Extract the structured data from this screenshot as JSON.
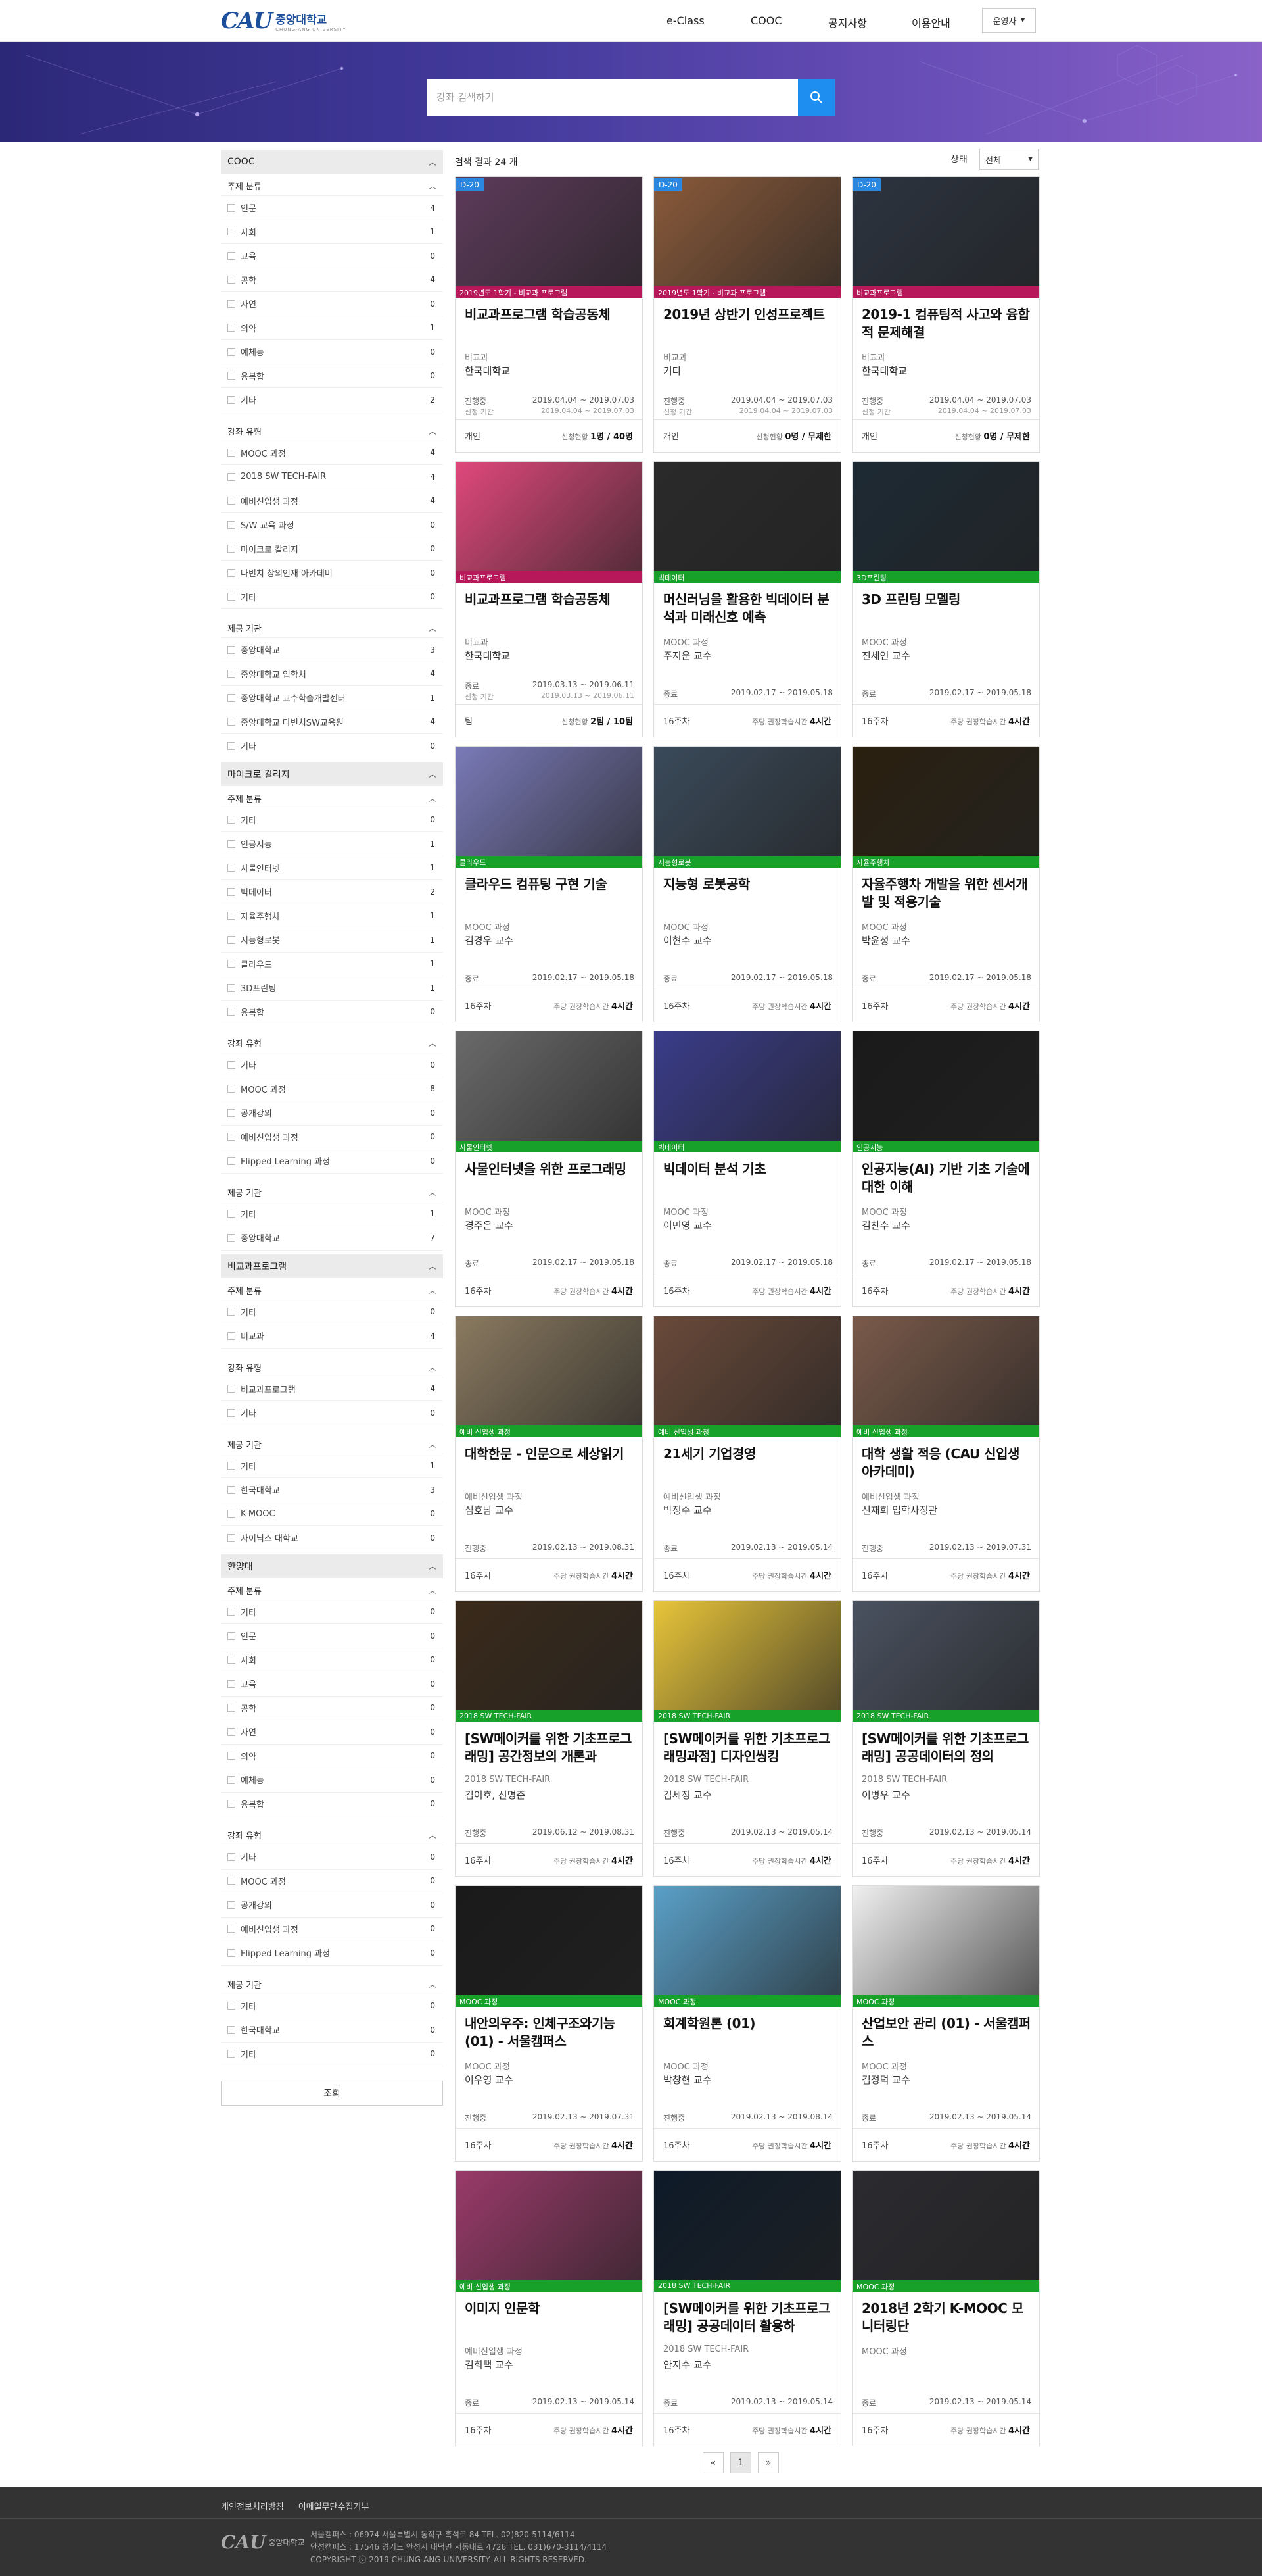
{
  "header": {
    "logo_mark": "CAU",
    "logo_kor": "중앙대학교",
    "logo_eng": "CHUNG-ANG UNIVERSITY",
    "nav": [
      "e-Class",
      "COOC",
      "공지사항",
      "이용안내"
    ],
    "operator_select": "운영자"
  },
  "search": {
    "placeholder": "강좌 검색하기"
  },
  "sidebar": {
    "groups": [
      {
        "title": "COOC",
        "subsections": [
          {
            "title": "주제 분류",
            "items": [
              [
                "인문",
                "4"
              ],
              [
                "사회",
                "1"
              ],
              [
                "교육",
                "0"
              ],
              [
                "공학",
                "4"
              ],
              [
                "자연",
                "0"
              ],
              [
                "의약",
                "1"
              ],
              [
                "예체능",
                "0"
              ],
              [
                "융복합",
                "0"
              ],
              [
                "기타",
                "2"
              ]
            ]
          },
          {
            "title": "강좌 유형",
            "items": [
              [
                "MOOC 과정",
                "4"
              ],
              [
                "2018 SW TECH-FAIR",
                "4"
              ],
              [
                "예비신입생 과정",
                "4"
              ],
              [
                "S/W 교육 과정",
                "0"
              ],
              [
                "마이크로 칼리지",
                "0"
              ],
              [
                "다빈치 창의인재 아카데미",
                "0"
              ],
              [
                "기타",
                "0"
              ]
            ]
          },
          {
            "title": "제공 기관",
            "items": [
              [
                "중앙대학교",
                "3"
              ],
              [
                "중앙대학교 입학처",
                "4"
              ],
              [
                "중앙대학교 교수학습개발센터",
                "1"
              ],
              [
                "중앙대학교 다빈치SW교육원",
                "4"
              ],
              [
                "기타",
                "0"
              ]
            ]
          }
        ]
      },
      {
        "title": "마이크로 칼리지",
        "subsections": [
          {
            "title": "주제 분류",
            "items": [
              [
                "기타",
                "0"
              ],
              [
                "인공지능",
                "1"
              ],
              [
                "사물인터넷",
                "1"
              ],
              [
                "빅데이터",
                "2"
              ],
              [
                "자율주행차",
                "1"
              ],
              [
                "지능형로봇",
                "1"
              ],
              [
                "클라우드",
                "1"
              ],
              [
                "3D프린팅",
                "1"
              ],
              [
                "융복합",
                "0"
              ]
            ]
          },
          {
            "title": "강좌 유형",
            "items": [
              [
                "기타",
                "0"
              ],
              [
                "MOOC 과정",
                "8"
              ],
              [
                "공개강의",
                "0"
              ],
              [
                "예비신입생 과정",
                "0"
              ],
              [
                "Flipped Learning 과정",
                "0"
              ]
            ]
          },
          {
            "title": "제공 기관",
            "items": [
              [
                "기타",
                "1"
              ],
              [
                "중앙대학교",
                "7"
              ]
            ]
          }
        ]
      },
      {
        "title": "비교과프로그램",
        "subsections": [
          {
            "title": "주제 분류",
            "items": [
              [
                "기타",
                "0"
              ],
              [
                "비교과",
                "4"
              ]
            ]
          },
          {
            "title": "강좌 유형",
            "items": [
              [
                "비교과프로그램",
                "4"
              ],
              [
                "기타",
                "0"
              ]
            ]
          },
          {
            "title": "제공 기관",
            "items": [
              [
                "기타",
                "1"
              ],
              [
                "한국대학교",
                "3"
              ],
              [
                "K-MOOC",
                "0"
              ],
              [
                "자이닉스 대학교",
                "0"
              ]
            ]
          }
        ]
      },
      {
        "title": "한양대",
        "subsections": [
          {
            "title": "주제 분류",
            "items": [
              [
                "기타",
                "0"
              ],
              [
                "인문",
                "0"
              ],
              [
                "사회",
                "0"
              ],
              [
                "교육",
                "0"
              ],
              [
                "공학",
                "0"
              ],
              [
                "자연",
                "0"
              ],
              [
                "의약",
                "0"
              ],
              [
                "예체능",
                "0"
              ],
              [
                "융복합",
                "0"
              ]
            ]
          },
          {
            "title": "강좌 유형",
            "items": [
              [
                "기타",
                "0"
              ],
              [
                "MOOC 과정",
                "0"
              ],
              [
                "공개강의",
                "0"
              ],
              [
                "예비신입생 과정",
                "0"
              ],
              [
                "Flipped Learning 과정",
                "0"
              ]
            ]
          },
          {
            "title": "제공 기관",
            "items": [
              [
                "기타",
                "0"
              ],
              [
                "한국대학교",
                "0"
              ],
              [
                "기타",
                "0"
              ]
            ]
          }
        ]
      }
    ],
    "query_button": "조회"
  },
  "main": {
    "result_count": "검색 결과 24 개",
    "status_label": "상태",
    "status_value": "전체"
  },
  "courses": [
    {
      "dday": "D-20",
      "cat": "2019년도 1학기 - 비교과 프로그램",
      "cat_color": "pink",
      "title": "비교과프로그램 학습공동체",
      "type": "비교과",
      "prof": "한국대학교",
      "state": "진행중",
      "period": "2019.04.04  ~  2019.07.03",
      "apply_label": "신청 기간",
      "apply": "2019.04.04  ~  2019.07.03",
      "foot_left": "개인",
      "foot_right_label": "신청현황",
      "foot_right": "1명 / 40명",
      "img": "#5d3a5a"
    },
    {
      "dday": "D-20",
      "cat": "2019년도 1학기 - 비교과 프로그램",
      "cat_color": "pink",
      "title": "2019년 상반기 인성프로젝트",
      "type": "비교과",
      "prof": "기타",
      "state": "진행중",
      "period": "2019.04.04  ~  2019.07.03",
      "apply_label": "신청 기간",
      "apply": "2019.04.04  ~  2019.07.03",
      "foot_left": "개인",
      "foot_right_label": "신청현황",
      "foot_right": "0명 / 무제한",
      "img": "#8a5a3a"
    },
    {
      "dday": "D-20",
      "cat": "비교과프로그램",
      "cat_color": "pink",
      "title": "2019-1 컴퓨팅적 사고와 융합적 문제해결",
      "type": "비교과",
      "prof": "한국대학교",
      "state": "진행중",
      "period": "2019.04.04  ~  2019.07.03",
      "apply_label": "신청 기간",
      "apply": "2019.04.04  ~  2019.07.03",
      "foot_left": "개인",
      "foot_right_label": "신청현황",
      "foot_right": "0명 / 무제한",
      "img": "#2c3440"
    },
    {
      "dday": "",
      "cat": "비교과프로그램",
      "cat_color": "pink",
      "title": "비교과프로그램 학습공동체",
      "type": "비교과",
      "prof": "한국대학교",
      "state": "종료",
      "period": "2019.03.13  ~  2019.06.11",
      "apply_label": "신청 기간",
      "apply": "2019.03.13  ~  2019.06.11",
      "foot_left": "팀",
      "foot_right_label": "신청현황",
      "foot_right": "2팀 / 10팀",
      "img": "#e0487c"
    },
    {
      "dday": "",
      "cat": "빅데이터",
      "cat_color": "green",
      "title": "머신러닝을 활용한 빅데이터 분석과 미래신호 예측",
      "type": "MOOC 과정",
      "prof": "주지운 교수",
      "state": "종료",
      "period": "2019.02.17  ~  2019.05.18",
      "apply_label": "",
      "apply": "",
      "foot_left": "16주차",
      "foot_right_label": "주당 권장학습시간",
      "foot_right": "4시간",
      "img": "#2a2a2a"
    },
    {
      "dday": "",
      "cat": "3D프린팅",
      "cat_color": "green",
      "title": "3D 프린팅 모델링",
      "type": "MOOC 과정",
      "prof": "진세연 교수",
      "state": "종료",
      "period": "2019.02.17  ~  2019.05.18",
      "apply_label": "",
      "apply": "",
      "foot_left": "16주차",
      "foot_right_label": "주당 권장학습시간",
      "foot_right": "4시간",
      "img": "#1d2a34"
    },
    {
      "dday": "",
      "cat": "클라우드",
      "cat_color": "green",
      "title": "클라우드 컴퓨팅 구현 기술",
      "type": "MOOC 과정",
      "prof": "김경우 교수",
      "state": "종료",
      "period": "2019.02.17  ~  2019.05.18",
      "apply_label": "",
      "apply": "",
      "foot_left": "16주차",
      "foot_right_label": "주당 권장학습시간",
      "foot_right": "4시간",
      "img": "#7a7ab8"
    },
    {
      "dday": "",
      "cat": "지능형로봇",
      "cat_color": "green",
      "title": "지능형 로봇공학",
      "type": "MOOC 과정",
      "prof": "이현수 교수",
      "state": "종료",
      "period": "2019.02.17  ~  2019.05.18",
      "apply_label": "",
      "apply": "",
      "foot_left": "16주차",
      "foot_right_label": "주당 권장학습시간",
      "foot_right": "4시간",
      "img": "#3a4a5a"
    },
    {
      "dday": "",
      "cat": "자율주행차",
      "cat_color": "green",
      "title": "자율주행차 개발을 위한 센서개발 및 적용기술",
      "type": "MOOC 과정",
      "prof": "박윤성 교수",
      "state": "종료",
      "period": "2019.02.17  ~  2019.05.18",
      "apply_label": "",
      "apply": "",
      "foot_left": "16주차",
      "foot_right_label": "주당 권장학습시간",
      "foot_right": "4시간",
      "img": "#2a2010"
    },
    {
      "dday": "",
      "cat": "사물인터넷",
      "cat_color": "green",
      "title": "사물인터넷을 위한 프로그래밍",
      "type": "MOOC 과정",
      "prof": "경주은 교수",
      "state": "종료",
      "period": "2019.02.17  ~  2019.05.18",
      "apply_label": "",
      "apply": "",
      "foot_left": "16주차",
      "foot_right_label": "주당 권장학습시간",
      "foot_right": "4시간",
      "img": "#6a6a6a"
    },
    {
      "dday": "",
      "cat": "빅데이터",
      "cat_color": "green",
      "title": "빅데이터 분석 기초",
      "type": "MOOC 과정",
      "prof": "이민영 교수",
      "state": "종료",
      "period": "2019.02.17  ~  2019.05.18",
      "apply_label": "",
      "apply": "",
      "foot_left": "16주차",
      "foot_right_label": "주당 권장학습시간",
      "foot_right": "4시간",
      "img": "#3a3c8a"
    },
    {
      "dday": "",
      "cat": "인공지능",
      "cat_color": "green",
      "title": "인공지능(AI) 기반 기초 기술에 대한 이해",
      "type": "MOOC 과정",
      "prof": "김찬수 교수",
      "state": "종료",
      "period": "2019.02.17  ~  2019.05.18",
      "apply_label": "",
      "apply": "",
      "foot_left": "16주차",
      "foot_right_label": "주당 권장학습시간",
      "foot_right": "4시간",
      "img": "#1a1a1a"
    },
    {
      "dday": "",
      "cat": "예비 신입생 과정",
      "cat_color": "green",
      "title": "대학한문 - 인문으로 세상읽기",
      "type": "예비신입생 과정",
      "prof": "심호남 교수",
      "state": "진행중",
      "period": "2019.02.13  ~  2019.08.31",
      "apply_label": "",
      "apply": "",
      "foot_left": "16주차",
      "foot_right_label": "주당 권장학습시간",
      "foot_right": "4시간",
      "img": "#8a7a60"
    },
    {
      "dday": "",
      "cat": "예비 신입생 과정",
      "cat_color": "green",
      "title": "21세기 기업경영",
      "type": "예비신입생 과정",
      "prof": "박정수 교수",
      "state": "종료",
      "period": "2019.02.13  ~  2019.05.14",
      "apply_label": "",
      "apply": "",
      "foot_left": "16주차",
      "foot_right_label": "주당 권장학습시간",
      "foot_right": "4시간",
      "img": "#6a4a3a"
    },
    {
      "dday": "",
      "cat": "예비 신입생 과정",
      "cat_color": "green",
      "title": "대학 생활 적응 (CAU 신입생 아카데미)",
      "type": "예비신입생 과정",
      "prof": "신재희 입학사정관",
      "state": "진행중",
      "period": "2019.02.13  ~  2019.07.31",
      "apply_label": "",
      "apply": "",
      "foot_left": "16주차",
      "foot_right_label": "주당 권장학습시간",
      "foot_right": "4시간",
      "img": "#7a5a4a"
    },
    {
      "dday": "",
      "cat": "2018 SW TECH-FAIR",
      "cat_color": "green",
      "title": "[SW메이커를 위한 기초프로그래밍] 공간정보의 개론과",
      "type": "2018 SW TECH-FAIR",
      "prof": "김이호, 신명준",
      "state": "진행중",
      "period": "2019.06.12  ~  2019.08.31",
      "apply_label": "",
      "apply": "",
      "foot_left": "16주차",
      "foot_right_label": "주당 권장학습시간",
      "foot_right": "4시간",
      "img": "#3a2a1a"
    },
    {
      "dday": "",
      "cat": "2018 SW TECH-FAIR",
      "cat_color": "green",
      "title": "[SW메이커를 위한 기초프로그래밍과정] 디자인씽킹",
      "type": "2018 SW TECH-FAIR",
      "prof": "김세정 교수",
      "state": "진행중",
      "period": "2019.02.13  ~  2019.05.14",
      "apply_label": "",
      "apply": "",
      "foot_left": "16주차",
      "foot_right_label": "주당 권장학습시간",
      "foot_right": "4시간",
      "img": "#e8c53a"
    },
    {
      "dday": "",
      "cat": "2018 SW TECH-FAIR",
      "cat_color": "green",
      "title": "[SW메이커를 위한 기초프로그래밍] 공공데이터의 정의",
      "type": "2018 SW TECH-FAIR",
      "prof": "이병우 교수",
      "state": "진행중",
      "period": "2019.02.13  ~  2019.05.14",
      "apply_label": "",
      "apply": "",
      "foot_left": "16주차",
      "foot_right_label": "주당 권장학습시간",
      "foot_right": "4시간",
      "img": "#4a5260"
    },
    {
      "dday": "",
      "cat": "MOOC 과정",
      "cat_color": "green",
      "title": "내안의우주: 인체구조와기능(01) - 서울캠퍼스",
      "type": "MOOC 과정",
      "prof": "이우영 교수",
      "state": "진행중",
      "period": "2019.02.13  ~  2019.07.31",
      "apply_label": "",
      "apply": "",
      "foot_left": "16주차",
      "foot_right_label": "주당 권장학습시간",
      "foot_right": "4시간",
      "img": "#1a1a1a"
    },
    {
      "dday": "",
      "cat": "MOOC 과정",
      "cat_color": "green",
      "title": "회계학원론 (01)",
      "type": "MOOC 과정",
      "prof": "박창현 교수",
      "state": "진행중",
      "period": "2019.02.13  ~  2019.08.14",
      "apply_label": "",
      "apply": "",
      "foot_left": "16주차",
      "foot_right_label": "주당 권장학습시간",
      "foot_right": "4시간",
      "img": "#5aa0c8"
    },
    {
      "dday": "",
      "cat": "MOOC 과정",
      "cat_color": "green",
      "title": "산업보안 관리 (01) - 서울캠퍼스",
      "type": "MOOC 과정",
      "prof": "김정덕 교수",
      "state": "종료",
      "period": "2019.02.13  ~  2019.05.14",
      "apply_label": "",
      "apply": "",
      "foot_left": "16주차",
      "foot_right_label": "주당 권장학습시간",
      "foot_right": "4시간",
      "img": "#f0f0f0"
    },
    {
      "dday": "",
      "cat": "예비 신입생 과정",
      "cat_color": "green",
      "title": "이미지 인문학",
      "type": "예비신입생 과정",
      "prof": "김희택 교수",
      "state": "종료",
      "period": "2019.02.13  ~  2019.05.14",
      "apply_label": "",
      "apply": "",
      "foot_left": "16주차",
      "foot_right_label": "주당 권장학습시간",
      "foot_right": "4시간",
      "img": "#9a3a6a"
    },
    {
      "dday": "",
      "cat": "2018 SW TECH-FAIR",
      "cat_color": "green",
      "title": "[SW메이커를 위한 기초프로그래밍] 공공데이터 활용하",
      "type": "2018 SW TECH-FAIR",
      "prof": "안지수 교수",
      "state": "종료",
      "period": "2019.02.13  ~  2019.05.14",
      "apply_label": "",
      "apply": "",
      "foot_left": "16주차",
      "foot_right_label": "주당 권장학습시간",
      "foot_right": "4시간",
      "img": "#0e1a28"
    },
    {
      "dday": "",
      "cat": "MOOC 과정",
      "cat_color": "green",
      "title": "2018년 2학기 K-MOOC 모니터링단",
      "type": "MOOC 과정",
      "prof": "",
      "state": "종료",
      "period": "2019.02.13  ~  2019.05.14",
      "apply_label": "",
      "apply": "",
      "foot_left": "16주차",
      "foot_right_label": "주당 권장학습시간",
      "foot_right": "4시간",
      "img": "#2b2b30"
    }
  ],
  "pagination": {
    "prev": "«",
    "current": "1",
    "next": "»"
  },
  "footer": {
    "links": [
      "개인정보처리방침",
      "이메일무단수집거부"
    ],
    "logo_mark": "CAU",
    "logo_text": "중앙대학교",
    "address": [
      "서울캠퍼스 : 06974 서울특별시 동작구 흑석로 84 TEL. 02)820-5114/6114",
      "안성캠퍼스 : 17546 경기도 안성시 대덕면 서동대로 4726 TEL. 031)670-3114/4114",
      "COPYRIGHT ⓒ 2019 CHUNG-ANG UNIVERSITY. ALL RIGHTS RESERVED."
    ]
  },
  "colors": {
    "accent": "#1f8ef1",
    "category_green": "#17a02a",
    "category_pink": "#b7185a",
    "banner_start": "#2c2878",
    "banner_end": "#8a62c8",
    "footer_bg": "#333333"
  }
}
